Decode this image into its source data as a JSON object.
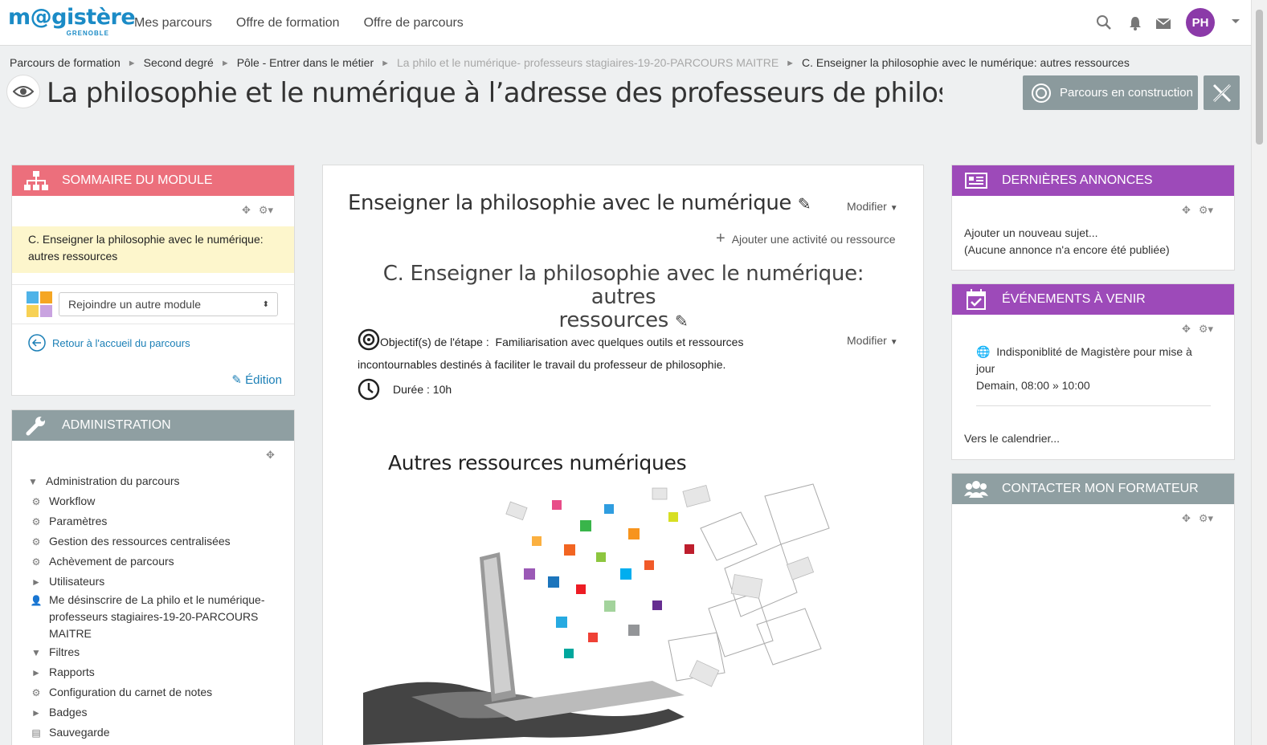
{
  "logo": {
    "main": "m@gistère",
    "sub": "GRENOBLE"
  },
  "nav": {
    "items": [
      "Mes parcours",
      "Offre de formation",
      "Offre de parcours"
    ]
  },
  "user": {
    "initials": "PH"
  },
  "breadcrumb": {
    "items": [
      "Parcours de formation",
      "Second degré",
      "Pôle - Entrer dans le métier",
      "La philo et le numérique- professeurs stagiaires-19-20-PARCOURS MAITRE",
      "C. Enseigner la philosophie avec le numérique: autres ressources"
    ]
  },
  "page": {
    "title": "La philosophie et le numérique à l’adresse des professeurs  de philosophie",
    "status_button": "Parcours en construction"
  },
  "sommaire": {
    "header": "SOMMAIRE DU MODULE",
    "current": "C. Enseigner la philosophie avec le numérique: autres ressources",
    "select": "Rejoindre un autre module",
    "back": "Retour à l'accueil du parcours",
    "edit": "Édition"
  },
  "admin": {
    "header": "ADMINISTRATION",
    "items": [
      "Administration du parcours",
      "Workflow",
      "Paramètres",
      "Gestion des ressources centralisées",
      "Achèvement de parcours",
      "Utilisateurs",
      "Me désinscrire de La philo et le numérique-",
      "professeurs stagiaires-19-20-PARCOURS",
      "MAITRE",
      "Filtres",
      "Rapports",
      "Configuration du carnet de notes",
      "Badges",
      "Sauvegarde"
    ]
  },
  "main": {
    "title": "Enseigner la philosophie avec le numérique",
    "modify": "Modifier",
    "add": "Ajouter une activité ou ressource",
    "section_line1": "C. Enseigner la philosophie avec le numérique: autres",
    "section_line2": "ressources",
    "objective_label": "Objectif(s) de l'étape :",
    "objective_text1": "Familiarisation avec quelques outils et ressources",
    "objective_text2": "incontournables destinés à faciliter le travail du professeur de philosophie.",
    "duration": "Durée : 10h",
    "image_title": "Autres ressources numériques"
  },
  "annonces": {
    "header": "DERNIÈRES ANNONCES",
    "add": "Ajouter un nouveau sujet...",
    "none": "(Aucune annonce n'a encore été publiée)"
  },
  "events": {
    "header": "ÉVÉNEMENTS À VENIR",
    "event1": "Indisponiblité de Magistère pour mise à",
    "event2": "jour",
    "date": "Demain, 08:00 » 10:00",
    "calendar": "Vers le calendrier..."
  },
  "contact": {
    "header": "CONTACTER MON FORMATEUR"
  },
  "colors": {
    "sommaire": "#ec6f7c",
    "admin": "#8f9fa2",
    "purple": "#9d4ab9",
    "link": "#1b7fb6"
  }
}
